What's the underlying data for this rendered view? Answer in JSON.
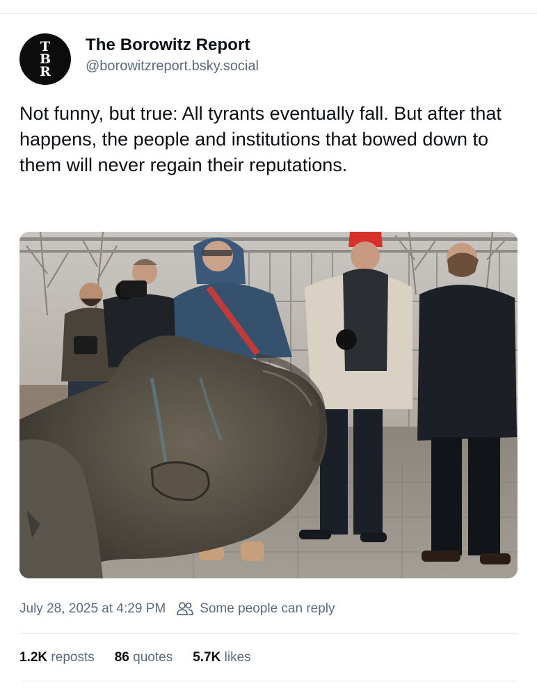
{
  "author": {
    "avatar_letters": [
      "T",
      "B",
      "R"
    ],
    "name": "The Borowitz Report",
    "handle": "@borowitzreport.bsky.social"
  },
  "post": {
    "text": "Not funny, but true: All tyrants eventually fall. But after that happens, the people and institutions that bowed down to them will never regain their reputations.",
    "timestamp": "July 28, 2025 at 4:29 PM",
    "reply_setting": "Some people can reply",
    "reply_icon": "people-icon"
  },
  "stats": {
    "reposts_count": "1.2K",
    "reposts_label": "reposts",
    "quotes_count": "86",
    "quotes_label": "quotes",
    "likes_count": "5.7K",
    "likes_label": "likes"
  },
  "colors": {
    "text": "#0b0f14",
    "muted": "#5b6b7d",
    "divider": "#e3e6ea"
  }
}
